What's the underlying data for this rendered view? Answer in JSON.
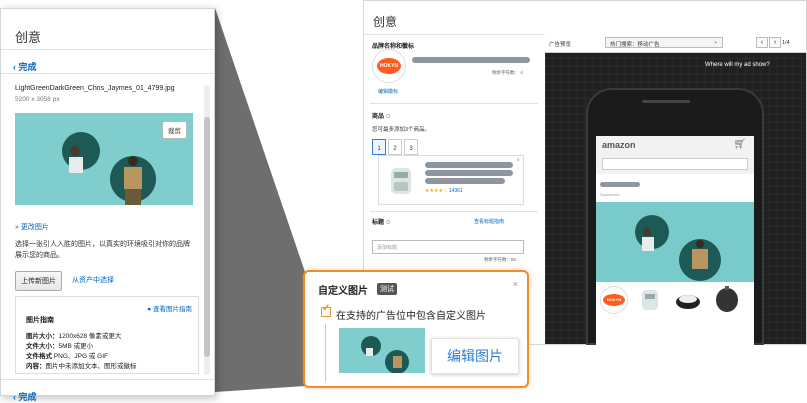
{
  "left_panel": {
    "title": "创意",
    "back_label": "完成",
    "back_label_bottom": "完成",
    "file_name": "LightGreenDarkGreen_Chris_Jaymes_01_4799.jpg",
    "dimensions": "5200 x 3058 px",
    "crop_button": "裁剪",
    "more_images": "更改图片",
    "description": "选择一张引人入胜的图片，以真实的环境吸引对你的品牌展示您的商品。",
    "upload_button": "上传新图片",
    "from_assets_link": "从资产中选择",
    "guidelines": {
      "link": "查看图片指南",
      "title": "图片指南",
      "rows": [
        {
          "key": "图片大小：",
          "value": "1200x628 像素或更大"
        },
        {
          "key": "文件大小：",
          "value": "5MB 或更小"
        },
        {
          "key": "文件格式",
          "value": "PNG、JPG 或 GIF"
        },
        {
          "key": "内容：",
          "value": "图片中未添加文本、图形或徽标"
        }
      ]
    }
  },
  "right_window": {
    "title": "创意",
    "brand_section_label": "品牌名称和徽标",
    "brand_logo_text": "HOKYN",
    "char_count": "剩余字符数：",
    "edit_logo": "编辑徽标",
    "product_label": "商品",
    "product_hint": "您可最多添加3个商品。",
    "product_tabs": [
      "1",
      "2",
      "3"
    ],
    "rating_count": "14361",
    "headline_label": "标题",
    "headline_link": "查看标题指南",
    "headline_placeholder": "添加标题",
    "headline_count": "剩余字符数：50",
    "preview": {
      "label": "广告预览",
      "select_value": "热门搜索：移动广告",
      "prev": "‹",
      "next": "›",
      "page": "1/4",
      "why_link": "Where will my ad show?",
      "amazon_logo": "amazon",
      "sponsored": "Sponsored",
      "brand_logo_text": "HOKYN"
    }
  },
  "callout": {
    "title": "自定义图片",
    "badge": "测试",
    "checkbox_label": "在支持的广告位中包含自定义图片",
    "checked": true,
    "edit_button": "编辑图片",
    "accent_color": "#f28b2a"
  }
}
